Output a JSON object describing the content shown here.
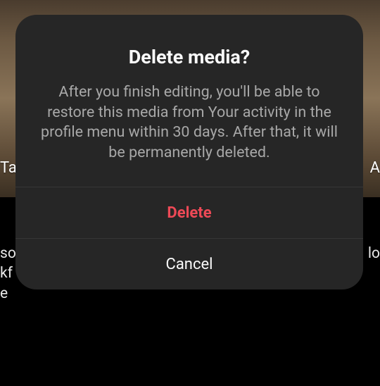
{
  "dialog": {
    "title": "Delete media?",
    "message": "After you finish editing, you'll be able to restore this media from Your activity in the profile menu within 30 days. After that, it will be permanently deleted.",
    "delete_label": "Delete",
    "cancel_label": "Cancel"
  },
  "background": {
    "left_fragment_top": "Ta",
    "right_fragment_top": "A",
    "left_fragment_lower": "so\nkf\ne",
    "right_fragment_lower": "lo"
  },
  "colors": {
    "dialog_bg": "#262626",
    "title": "#fafafa",
    "message": "#a8a8a8",
    "destructive": "#ed4956",
    "separator": "#363636"
  }
}
